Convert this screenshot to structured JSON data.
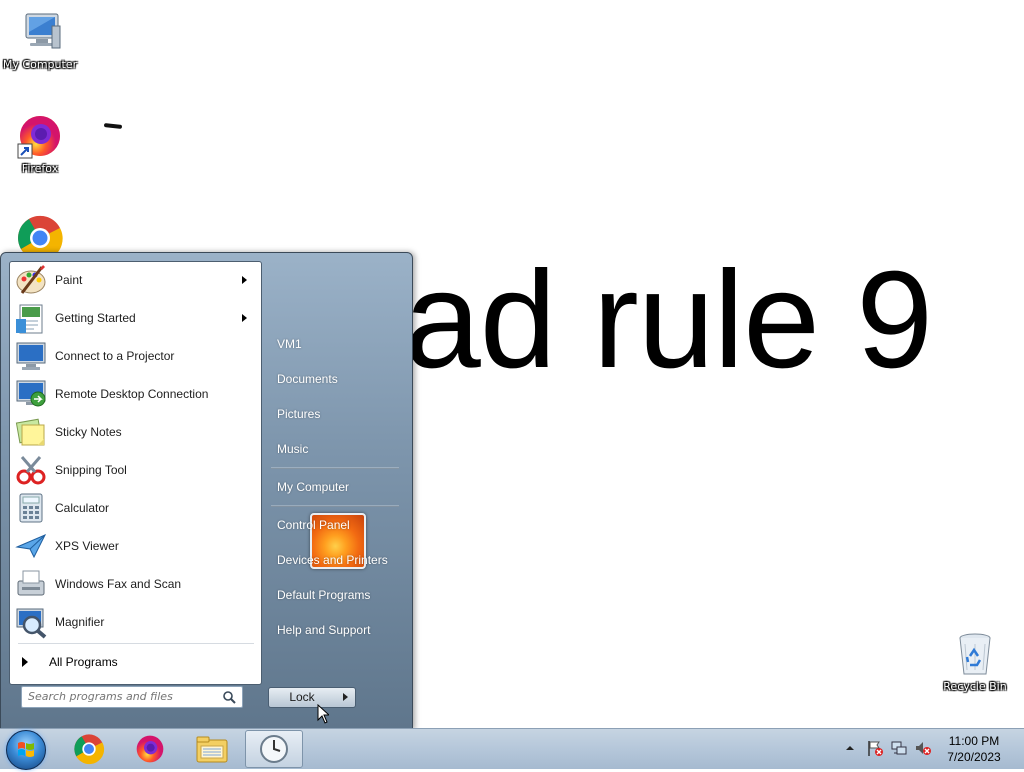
{
  "desktop": {
    "wallpaper_text": "ad rule 9",
    "icons": [
      {
        "label": "My Computer",
        "icon": "computer-icon"
      },
      {
        "label": "Firefox",
        "icon": "firefox-icon"
      },
      {
        "label": "",
        "icon": "chrome-icon"
      },
      {
        "label": "Recycle Bin",
        "icon": "recycle-bin-icon"
      }
    ]
  },
  "start_menu": {
    "programs": [
      {
        "label": "Paint",
        "icon": "paint-icon",
        "has_submenu": true
      },
      {
        "label": "Getting Started",
        "icon": "getting-started-icon",
        "has_submenu": true
      },
      {
        "label": "Connect to a Projector",
        "icon": "projector-icon",
        "has_submenu": false
      },
      {
        "label": "Remote Desktop Connection",
        "icon": "remote-desktop-icon",
        "has_submenu": false
      },
      {
        "label": "Sticky Notes",
        "icon": "sticky-notes-icon",
        "has_submenu": false
      },
      {
        "label": "Snipping Tool",
        "icon": "snipping-tool-icon",
        "has_submenu": false
      },
      {
        "label": "Calculator",
        "icon": "calculator-icon",
        "has_submenu": false
      },
      {
        "label": "XPS Viewer",
        "icon": "xps-viewer-icon",
        "has_submenu": false
      },
      {
        "label": "Windows Fax and Scan",
        "icon": "fax-scan-icon",
        "has_submenu": false
      },
      {
        "label": "Magnifier",
        "icon": "magnifier-icon",
        "has_submenu": false
      }
    ],
    "all_programs_label": "All Programs",
    "search_placeholder": "Search programs and files",
    "right_items": [
      "VM1",
      "Documents",
      "Pictures",
      "Music",
      "My Computer",
      "Control Panel",
      "Devices and Printers",
      "Default Programs",
      "Help and Support"
    ],
    "lock_label": "Lock"
  },
  "taskbar": {
    "pinned": [
      "chrome-icon",
      "firefox-icon",
      "file-explorer-icon",
      "clock-icon"
    ],
    "tray_icons": [
      "show-hidden-icons-icon",
      "action-center-flag-icon",
      "network-icon",
      "volume-muted-icon"
    ],
    "clock_time": "11:00 PM",
    "clock_date": "7/20/2023"
  }
}
